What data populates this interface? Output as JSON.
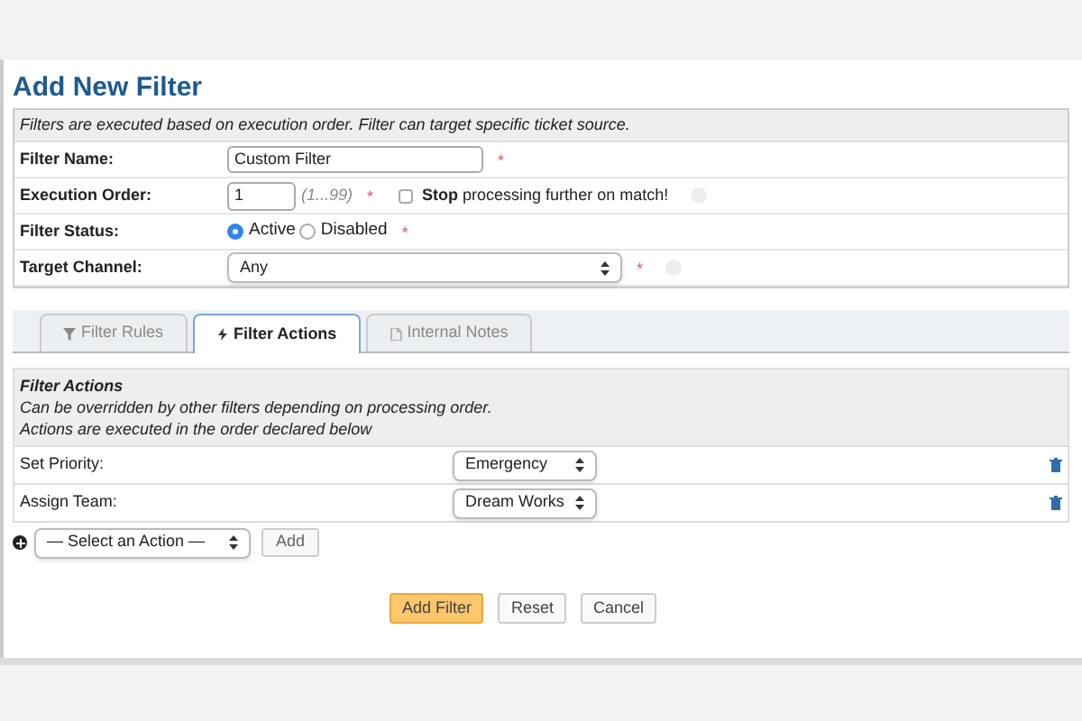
{
  "page_title": "Add New Filter",
  "info": "Filters are executed based on execution order. Filter can target specific ticket source.",
  "fields": [
    {
      "kind": "text",
      "label": "Filter Name:",
      "value": "Custom Filter",
      "required_mark": "*"
    },
    {
      "kind": "order",
      "label": "Execution Order:",
      "value": "1",
      "hint": "(1...99)",
      "required_mark": "*",
      "stop": {
        "label": "**Stop** processing further on match!",
        "checked": false
      }
    },
    {
      "kind": "radio",
      "label": "Filter Status:",
      "required_mark": "*",
      "options": [
        {
          "label": "Active",
          "selected": true
        },
        {
          "label": "Disabled",
          "selected": false
        }
      ]
    },
    {
      "kind": "select",
      "label": "Target Channel:",
      "value": "Any",
      "required_mark": "*"
    }
  ],
  "tabs": [
    {
      "label": "Filter Rules",
      "selected": false
    },
    {
      "label": "Filter Actions",
      "selected": true
    },
    {
      "label": "Internal Notes",
      "selected": false
    }
  ],
  "actions_header": {
    "title": "Filter Actions",
    "lines": [
      "Can be overridden by other filters depending on processing order.",
      "Actions are executed in the order declared below"
    ]
  },
  "actions": [
    {
      "label": "Set Priority:",
      "value": "Emergency"
    },
    {
      "label": "Assign Team:",
      "value": "Dream Works"
    }
  ],
  "add_action": {
    "placeholder": "— Select an Action —",
    "button": "Add"
  },
  "buttons": [
    {
      "label": "Add Filter",
      "kind": "primary"
    },
    {
      "label": "Reset",
      "kind": "default"
    },
    {
      "label": "Cancel",
      "kind": "default"
    }
  ]
}
